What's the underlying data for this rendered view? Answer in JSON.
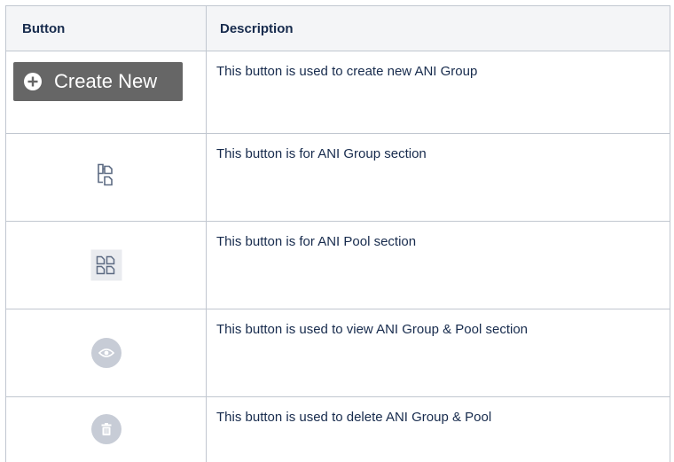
{
  "table": {
    "headers": {
      "button": "Button",
      "description": "Description"
    },
    "rows": [
      {
        "icon": "plus-circle-icon",
        "button_label": "Create New",
        "description": "This button is used to create new ANI Group"
      },
      {
        "icon": "ani-group-icon",
        "description": "This button is for ANI Group section"
      },
      {
        "icon": "ani-pool-icon",
        "description": "This button is for ANI Pool section"
      },
      {
        "icon": "eye-icon",
        "description": "This button is used to view ANI Group & Pool section"
      },
      {
        "icon": "trash-icon",
        "description": "This button is used to delete ANI Group & Pool"
      }
    ]
  },
  "colors": {
    "create_button_bg": "#666666",
    "border": "#c1c7d0",
    "header_bg": "#f4f5f7",
    "icon_gray": "#c7ccd6"
  }
}
